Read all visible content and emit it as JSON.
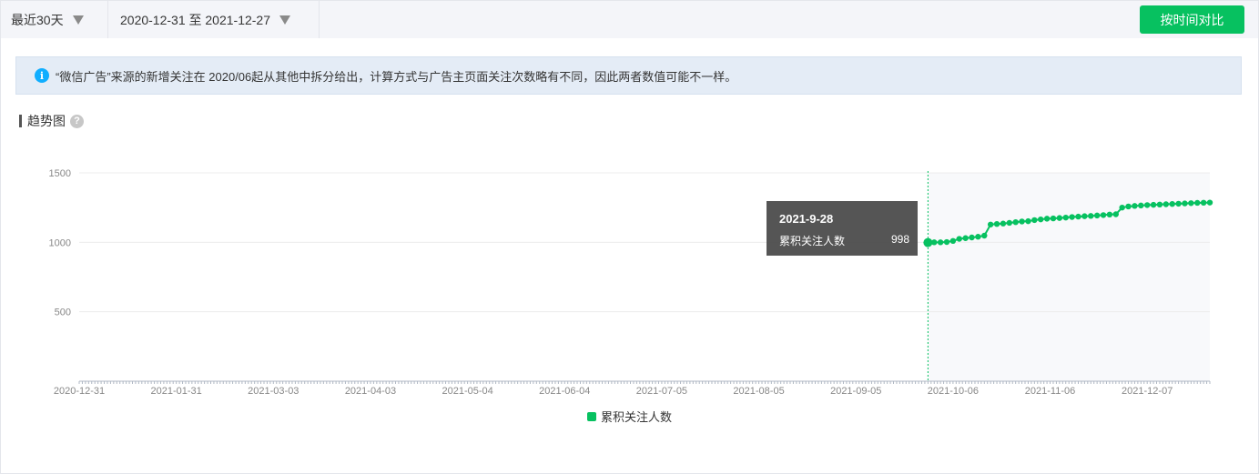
{
  "toolbar": {
    "range_label": "最近30天",
    "date_range": "2020-12-31 至 2021-12-27",
    "compare_button": "按时间对比"
  },
  "notice": {
    "icon": "info-icon",
    "text": "“微信广告”来源的新增关注在 2020/06起从其他中拆分给出，计算方式与广告主页面关注次数略有不同，因此两者数值可能不一样。"
  },
  "section": {
    "title": "趋势图",
    "help_icon": "question-icon"
  },
  "tooltip": {
    "date": "2021-9-28",
    "series_name": "累积关注人数",
    "value": "998"
  },
  "chart_data": {
    "type": "line",
    "title": "",
    "xlabel": "",
    "ylabel": "",
    "x_tick_labels": [
      "2020-12-31",
      "2021-01-31",
      "2021-03-03",
      "2021-04-03",
      "2021-05-04",
      "2021-06-04",
      "2021-07-05",
      "2021-08-05",
      "2021-09-05",
      "2021-10-06",
      "2021-11-06",
      "2021-12-07"
    ],
    "y_ticks": [
      500,
      1000,
      1500
    ],
    "ylim": [
      0,
      1500
    ],
    "xlim": [
      "2020-12-31",
      "2021-12-27"
    ],
    "legend_position": "bottom-center",
    "highlight_date": "2021-09-28",
    "series": [
      {
        "name": "累积关注人数",
        "color": "#07c160",
        "x": [
          "2021-09-28",
          "2021-09-30",
          "2021-10-02",
          "2021-10-04",
          "2021-10-06",
          "2021-10-08",
          "2021-10-10",
          "2021-10-12",
          "2021-10-14",
          "2021-10-16",
          "2021-10-18",
          "2021-10-20",
          "2021-10-22",
          "2021-10-24",
          "2021-10-26",
          "2021-10-28",
          "2021-10-30",
          "2021-11-01",
          "2021-11-03",
          "2021-11-05",
          "2021-11-07",
          "2021-11-09",
          "2021-11-11",
          "2021-11-13",
          "2021-11-15",
          "2021-11-17",
          "2021-11-19",
          "2021-11-21",
          "2021-11-23",
          "2021-11-25",
          "2021-11-27",
          "2021-11-29",
          "2021-12-01",
          "2021-12-03",
          "2021-12-05",
          "2021-12-07",
          "2021-12-09",
          "2021-12-11",
          "2021-12-13",
          "2021-12-15",
          "2021-12-17",
          "2021-12-19",
          "2021-12-21",
          "2021-12-23",
          "2021-12-25",
          "2021-12-27"
        ],
        "y": [
          998,
          1000,
          1000,
          1002,
          1010,
          1025,
          1030,
          1035,
          1040,
          1048,
          1128,
          1132,
          1135,
          1140,
          1145,
          1150,
          1152,
          1160,
          1165,
          1170,
          1172,
          1175,
          1178,
          1182,
          1185,
          1188,
          1190,
          1193,
          1196,
          1200,
          1202,
          1250,
          1258,
          1262,
          1265,
          1268,
          1270,
          1272,
          1274,
          1276,
          1278,
          1280,
          1282,
          1284,
          1285,
          1286
        ]
      }
    ]
  }
}
